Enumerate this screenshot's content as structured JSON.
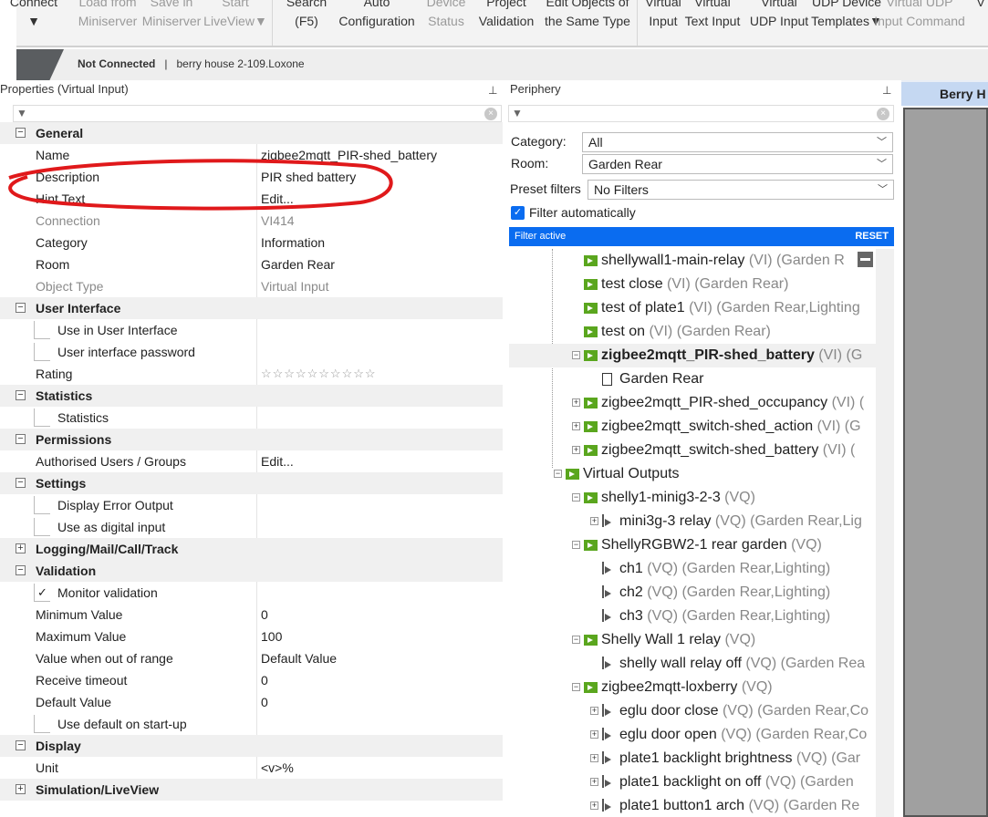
{
  "toolbar": {
    "groups": [
      [
        {
          "l1": "Connect",
          "l2": "▼",
          "dis": false
        },
        {
          "l1": "Load from",
          "l2": "Miniserver",
          "dis": true
        },
        {
          "l1": "Save in",
          "l2": "Miniserver",
          "dis": true
        },
        {
          "l1": "Start",
          "l2": "LiveView▼",
          "dis": true
        }
      ],
      [
        {
          "l1": "Search",
          "l2": "(F5)",
          "dis": false
        },
        {
          "l1": "Auto",
          "l2": "Configuration",
          "dis": false
        },
        {
          "l1": "Device",
          "l2": "Status",
          "dis": true
        },
        {
          "l1": "Project",
          "l2": "Validation",
          "dis": false
        },
        {
          "l1": "Edit Objects of",
          "l2": "the Same Type",
          "dis": false
        }
      ],
      [
        {
          "l1": "Virtual",
          "l2": "Input",
          "dis": false
        },
        {
          "l1": "Virtual",
          "l2": "Text Input",
          "dis": false
        },
        {
          "l1": "Virtual",
          "l2": "UDP Input",
          "dis": false
        },
        {
          "l1": "UDP Device",
          "l2": "Templates▼",
          "dis": false
        },
        {
          "l1": "Virtual UDP",
          "l2": "Input Command",
          "dis": true
        },
        {
          "l1": "",
          "l2": "V",
          "dis": false
        }
      ]
    ]
  },
  "status": {
    "connection": "Not Connected",
    "separator": "|",
    "project": "berry house 2-109.Loxone"
  },
  "properties": {
    "title": "Properties (Virtual Input)",
    "pin": "⊥",
    "rows": [
      {
        "type": "sec",
        "name": "General",
        "exp": "−"
      },
      {
        "type": "row",
        "name": "Name",
        "value": "zigbee2mqtt_PIR-shed_battery"
      },
      {
        "type": "row",
        "name": "Description",
        "value": "PIR shed battery"
      },
      {
        "type": "row",
        "name": "Hint Text",
        "value": "Edit..."
      },
      {
        "type": "dim",
        "name": "Connection",
        "value": "VI414"
      },
      {
        "type": "row",
        "name": "Category",
        "value": "Information"
      },
      {
        "type": "row",
        "name": "Room",
        "value": "Garden Rear"
      },
      {
        "type": "dim",
        "name": "Object Type",
        "value": "Virtual Input"
      },
      {
        "type": "sec",
        "name": "User Interface",
        "exp": "−"
      },
      {
        "type": "chk",
        "name": "Use in User Interface",
        "checked": false
      },
      {
        "type": "chk",
        "name": "User interface password",
        "checked": false
      },
      {
        "type": "row",
        "name": "Rating",
        "value": "☆☆☆☆☆☆☆☆☆☆",
        "stars": true
      },
      {
        "type": "sec",
        "name": "Statistics",
        "exp": "−"
      },
      {
        "type": "chk",
        "name": "Statistics",
        "checked": false
      },
      {
        "type": "sec",
        "name": "Permissions",
        "exp": "−"
      },
      {
        "type": "row",
        "name": "Authorised Users / Groups",
        "value": "Edit..."
      },
      {
        "type": "sec",
        "name": "Settings",
        "exp": "−"
      },
      {
        "type": "chk",
        "name": "Display Error Output",
        "checked": false
      },
      {
        "type": "chk",
        "name": "Use as digital input",
        "checked": false
      },
      {
        "type": "sec",
        "name": "Logging/Mail/Call/Track",
        "exp": "+"
      },
      {
        "type": "sec",
        "name": "Validation",
        "exp": "−"
      },
      {
        "type": "chk",
        "name": "Monitor validation",
        "checked": true
      },
      {
        "type": "row",
        "name": "Minimum Value",
        "value": "0"
      },
      {
        "type": "row",
        "name": "Maximum Value",
        "value": "100"
      },
      {
        "type": "row",
        "name": "Value when out of range",
        "value": "Default Value"
      },
      {
        "type": "row",
        "name": "Receive timeout",
        "value": "0"
      },
      {
        "type": "row",
        "name": "Default Value",
        "value": "0"
      },
      {
        "type": "chk",
        "name": "Use default on start-up",
        "checked": false
      },
      {
        "type": "sec",
        "name": "Display",
        "exp": "−"
      },
      {
        "type": "row",
        "name": "Unit",
        "value": "<v>%"
      },
      {
        "type": "sec",
        "name": "Simulation/LiveView",
        "exp": "+"
      }
    ]
  },
  "periphery": {
    "title": "Periphery",
    "pin": "⊥",
    "category_label": "Category:",
    "category_value": "All",
    "room_label": "Room:",
    "room_value": "Garden Rear",
    "preset_label": "Preset filters",
    "preset_value": "No Filters",
    "auto_filter_label": "Filter automatically",
    "auto_filter_checked": true,
    "filter_active": "Filter active",
    "reset": "RESET",
    "tree": [
      {
        "lvl": 2,
        "icon": "in",
        "name": "shellywall1-main-relay",
        "suffix": " (VI) (Garden R"
      },
      {
        "lvl": 2,
        "icon": "in",
        "name": "test close",
        "suffix": " (VI) (Garden Rear)"
      },
      {
        "lvl": 2,
        "icon": "in",
        "name": "test of plate1",
        "suffix": " (VI) (Garden Rear,Lighting"
      },
      {
        "lvl": 2,
        "icon": "in",
        "name": "test on",
        "suffix": " (VI) (Garden Rear)"
      },
      {
        "lvl": 2,
        "icon": "in",
        "name": "zigbee2mqtt_PIR-shed_battery",
        "suffix": " (VI) (G",
        "exp": "−",
        "bold": true
      },
      {
        "lvl": 3,
        "icon": "doc",
        "name": "Garden Rear",
        "suffix": ""
      },
      {
        "lvl": 2,
        "icon": "in",
        "name": "zigbee2mqtt_PIR-shed_occupancy",
        "suffix": " (VI) (",
        "exp": "+"
      },
      {
        "lvl": 2,
        "icon": "in",
        "name": "zigbee2mqtt_switch-shed_action",
        "suffix": " (VI) (G",
        "exp": "+"
      },
      {
        "lvl": 2,
        "icon": "in",
        "name": "zigbee2mqtt_switch-shed_battery",
        "suffix": " (VI) (",
        "exp": "+"
      },
      {
        "lvl": 1,
        "icon": "in",
        "name": "Virtual Outputs",
        "suffix": "",
        "exp": "−"
      },
      {
        "lvl": 2,
        "icon": "in",
        "name": "shelly1-minig3-2-3",
        "suffix": " (VQ)",
        "exp": "−"
      },
      {
        "lvl": 3,
        "icon": "out",
        "name": "mini3g-3 relay",
        "suffix": " (VQ) (Garden Rear,Lig",
        "exp": "+"
      },
      {
        "lvl": 2,
        "icon": "in",
        "name": "ShellyRGBW2-1 rear garden",
        "suffix": " (VQ)",
        "exp": "−"
      },
      {
        "lvl": 3,
        "icon": "out",
        "name": "ch1",
        "suffix": " (VQ) (Garden Rear,Lighting)"
      },
      {
        "lvl": 3,
        "icon": "out",
        "name": "ch2",
        "suffix": " (VQ) (Garden Rear,Lighting)"
      },
      {
        "lvl": 3,
        "icon": "out",
        "name": "ch3",
        "suffix": " (VQ) (Garden Rear,Lighting)"
      },
      {
        "lvl": 2,
        "icon": "in",
        "name": "Shelly Wall 1 relay",
        "suffix": " (VQ)",
        "exp": "−"
      },
      {
        "lvl": 3,
        "icon": "out",
        "name": "shelly wall relay off",
        "suffix": " (VQ) (Garden Rea"
      },
      {
        "lvl": 2,
        "icon": "in",
        "name": "zigbee2mqtt-loxberry",
        "suffix": " (VQ)",
        "exp": "−"
      },
      {
        "lvl": 3,
        "icon": "out",
        "name": "eglu door close",
        "suffix": " (VQ) (Garden Rear,Co",
        "exp": "+"
      },
      {
        "lvl": 3,
        "icon": "out",
        "name": "eglu door open",
        "suffix": " (VQ) (Garden Rear,Co",
        "exp": "+"
      },
      {
        "lvl": 3,
        "icon": "out",
        "name": "plate1 backlight brightness",
        "suffix": " (VQ) (Gar",
        "exp": "+"
      },
      {
        "lvl": 3,
        "icon": "out",
        "name": "plate1 backlight on off",
        "suffix": " (VQ) (Garden",
        "exp": "+"
      },
      {
        "lvl": 3,
        "icon": "out",
        "name": "plate1 button1 arch",
        "suffix": " (VQ) (Garden Re",
        "exp": "+"
      }
    ]
  },
  "document_tab": {
    "label": "Berry H"
  },
  "colors": {
    "accent": "#0a6cf0",
    "vi_icon": "#5aa61e",
    "annotation": "#e0191b"
  }
}
